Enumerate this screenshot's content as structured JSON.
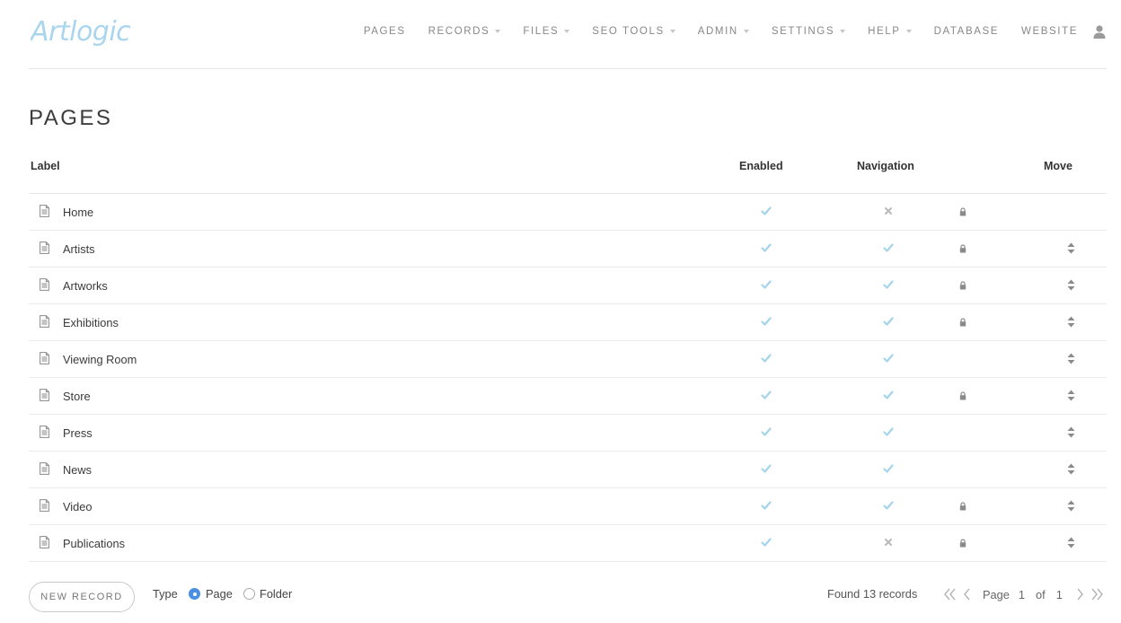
{
  "brand": {
    "logo_text": "Artlogic"
  },
  "nav": {
    "items": [
      {
        "label": "PAGES",
        "caret": false
      },
      {
        "label": "RECORDS",
        "caret": true
      },
      {
        "label": "FILES",
        "caret": true
      },
      {
        "label": "SEO TOOLS",
        "caret": true
      },
      {
        "label": "ADMIN",
        "caret": true
      },
      {
        "label": "SETTINGS",
        "caret": true
      },
      {
        "label": "HELP",
        "caret": true
      },
      {
        "label": "DATABASE",
        "caret": false
      },
      {
        "label": "WEBSITE",
        "caret": false
      }
    ]
  },
  "page": {
    "title": "PAGES"
  },
  "table": {
    "headers": {
      "label": "Label",
      "enabled": "Enabled",
      "navigation": "Navigation",
      "move": "Move"
    },
    "rows": [
      {
        "label": "Home",
        "enabled": true,
        "navigation": false,
        "locked": true,
        "movable": false
      },
      {
        "label": "Artists",
        "enabled": true,
        "navigation": true,
        "locked": true,
        "movable": true
      },
      {
        "label": "Artworks",
        "enabled": true,
        "navigation": true,
        "locked": true,
        "movable": true
      },
      {
        "label": "Exhibitions",
        "enabled": true,
        "navigation": true,
        "locked": true,
        "movable": true
      },
      {
        "label": "Viewing Room",
        "enabled": true,
        "navigation": true,
        "locked": false,
        "movable": true
      },
      {
        "label": "Store",
        "enabled": true,
        "navigation": true,
        "locked": true,
        "movable": true
      },
      {
        "label": "Press",
        "enabled": true,
        "navigation": true,
        "locked": false,
        "movable": true
      },
      {
        "label": "News",
        "enabled": true,
        "navigation": true,
        "locked": false,
        "movable": true
      },
      {
        "label": "Video",
        "enabled": true,
        "navigation": true,
        "locked": true,
        "movable": true
      },
      {
        "label": "Publications",
        "enabled": true,
        "navigation": false,
        "locked": true,
        "movable": true
      }
    ]
  },
  "footer": {
    "new_record_label": "NEW RECORD",
    "type_label": "Type",
    "type_options": {
      "page": "Page",
      "folder": "Folder"
    },
    "selected_type": "page",
    "found_text": "Found 13 records",
    "pager": {
      "page_label": "Page",
      "current": "1",
      "of_label": "of",
      "total": "1"
    }
  },
  "colors": {
    "logo": "#a9d6ee",
    "check": "#a4d4ec",
    "cross": "#b9b9b9",
    "icon_gray": "#8a8a8a",
    "radio_selected": "#4a90e2"
  }
}
